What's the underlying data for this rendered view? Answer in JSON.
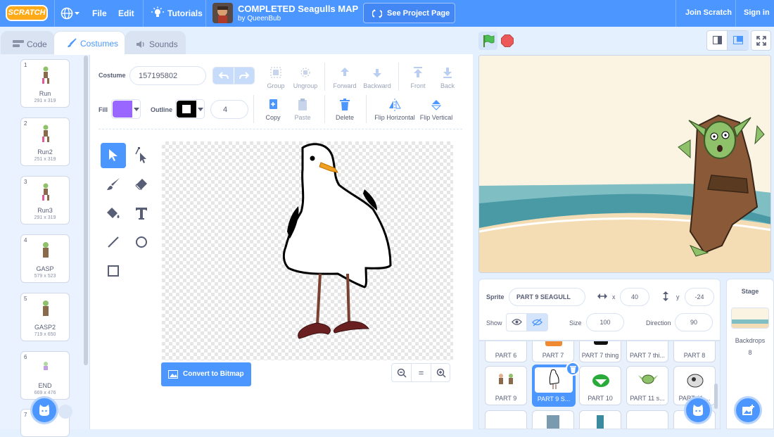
{
  "menubar": {
    "logo": "SCRATCH",
    "file": "File",
    "edit": "Edit",
    "tutorials": "Tutorials",
    "project_title": "COMPLETED Seagulls MAP",
    "project_author": "by QueenBub",
    "see_project": "See Project Page",
    "join": "Join Scratch",
    "signin": "Sign in",
    "bg_color": "#4c97ff"
  },
  "tabs": [
    {
      "label": "Code",
      "icon": "code-icon"
    },
    {
      "label": "Costumes",
      "icon": "brush-icon"
    },
    {
      "label": "Sounds",
      "icon": "speaker-icon"
    }
  ],
  "costumes": [
    {
      "num": "1",
      "name": "Run",
      "size": "291 x 319"
    },
    {
      "num": "2",
      "name": "Run2",
      "size": "251 x 319"
    },
    {
      "num": "3",
      "name": "Run3",
      "size": "291 x 319"
    },
    {
      "num": "4",
      "name": "GASP",
      "size": "579 x 523"
    },
    {
      "num": "5",
      "name": "GASP2",
      "size": "719 x 650"
    },
    {
      "num": "6",
      "name": "END",
      "size": "669 x 476"
    },
    {
      "num": "7"
    }
  ],
  "editor": {
    "costume_label": "Costume",
    "costume_name": "157195802",
    "group": "Group",
    "ungroup": "Ungroup",
    "forward": "Forward",
    "backward": "Backward",
    "front": "Front",
    "back": "Back",
    "fill_label": "Fill",
    "outline_label": "Outline",
    "outline_width": "4",
    "copy": "Copy",
    "paste": "Paste",
    "delete": "Delete",
    "flip_h": "Flip Horizontal",
    "flip_v": "Flip Vertical",
    "fill_color": "#9966ff",
    "convert": "Convert to Bitmap",
    "zoom_reset": "="
  },
  "sprite_info": {
    "sprite_label": "Sprite",
    "sprite_name": "PART 9 SEAGULL",
    "x_label": "x",
    "x": "40",
    "y_label": "y",
    "y": "-24",
    "show_label": "Show",
    "size_label": "Size",
    "size": "100",
    "direction_label": "Direction",
    "direction": "90"
  },
  "sprites_row1": [
    "PART 6",
    "PART 7",
    "PART 7 thing",
    "PART 7 thi...",
    "PART 8"
  ],
  "sprites_row2": [
    "PART 9",
    "PART 9 S...",
    "PART 10",
    "PART 11 s...",
    "PART 11 ..."
  ],
  "stage_panel": {
    "title": "Stage",
    "backdrops_label": "Backdrops",
    "backdrops_count": "8"
  }
}
